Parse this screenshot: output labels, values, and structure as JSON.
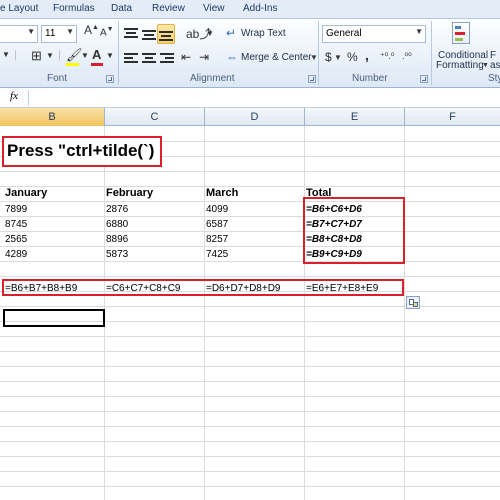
{
  "ribbon_tabs": [
    "e Layout",
    "Formulas",
    "Data",
    "Review",
    "View",
    "Add-Ins"
  ],
  "font": {
    "size": "11",
    "group_label": "Font"
  },
  "alignment": {
    "wrap_text": "Wrap Text",
    "merge_center": "Merge & Center",
    "group_label": "Alignment"
  },
  "number": {
    "format": "General",
    "group_label": "Number",
    "symbols": [
      "$",
      "%",
      ","
    ]
  },
  "styles": {
    "conditional_line1": "Conditional",
    "conditional_line2": "Formatting",
    "partial_1": "F",
    "partial_2": "as",
    "group_label_partial": "Sty"
  },
  "formula_bar": {
    "fx": "fx",
    "value": ""
  },
  "columns": [
    "B",
    "C",
    "D",
    "E",
    "F"
  ],
  "selected_column": "B",
  "instruction": "Press \"ctrl+tilde(`)",
  "table": {
    "headers": [
      "January",
      "February",
      "March",
      "Total"
    ],
    "rows": [
      [
        "7899",
        "2876",
        "4099",
        "=B6+C6+D6"
      ],
      [
        "8745",
        "6880",
        "6587",
        "=B7+C7+D7"
      ],
      [
        "2565",
        "8896",
        "8257",
        "=B8+C8+D8"
      ],
      [
        "4289",
        "5873",
        "7425",
        "=B9+C9+D9"
      ]
    ],
    "sum_formulas": [
      "=B6+B7+B8+B9",
      "=C6+C7+C8+C9",
      "=D6+D7+D8+D9",
      "=E6+E7+E8+E9"
    ]
  },
  "colors": {
    "highlight_red": "#d8212a",
    "ribbon_blue": "#dde8f5",
    "selected_header": "#f1c15f"
  }
}
